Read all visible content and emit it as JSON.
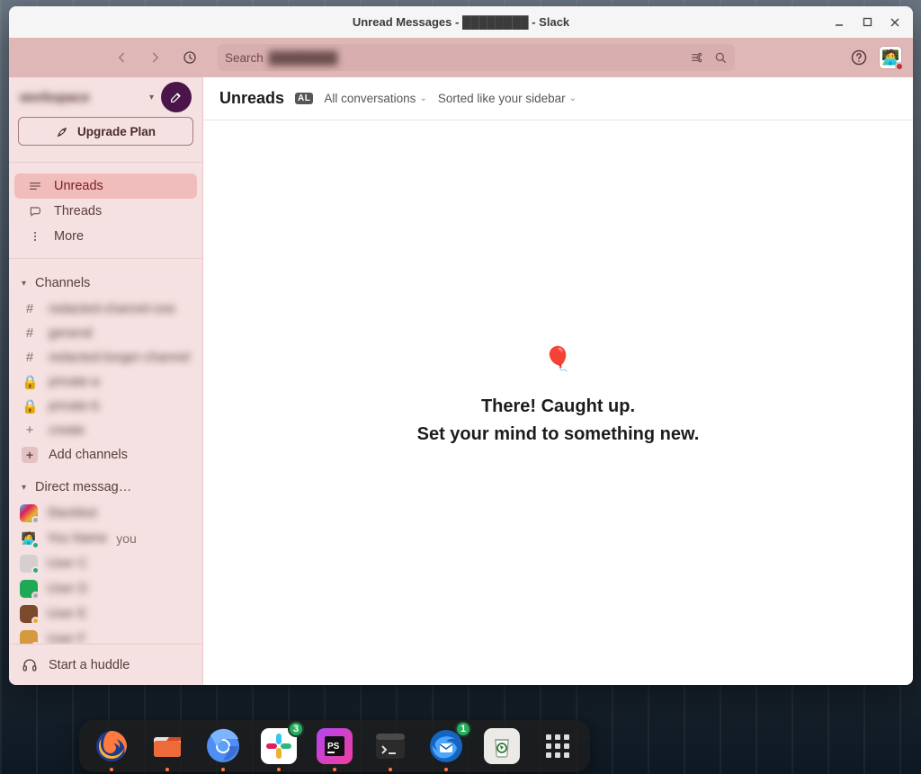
{
  "titlebar": {
    "title": "Unread Messages - ████████ - Slack"
  },
  "toolbar": {
    "search_label": "Search",
    "search_value": "████████"
  },
  "sidebar": {
    "workspace_name": "workspace",
    "upgrade_label": "Upgrade Plan",
    "items": [
      {
        "label": "Unreads"
      },
      {
        "label": "Threads"
      },
      {
        "label": "More"
      }
    ],
    "channels_header": "Channels",
    "channels": [
      {
        "kind": "hash",
        "label": "redacted-channel-one"
      },
      {
        "kind": "hash",
        "label": "general"
      },
      {
        "kind": "hash",
        "label": "redacted-longer-channel"
      },
      {
        "kind": "lock",
        "label": "private-a"
      },
      {
        "kind": "lock",
        "label": "private-b"
      },
      {
        "kind": "plus",
        "label": "create"
      }
    ],
    "add_channels_label": "Add channels",
    "dm_header": "Direct messag…",
    "you_suffix": "you",
    "dms": [
      {
        "name": "Slackbot",
        "bg": "linear-gradient(135deg,#36c5f0,#e01e5a,#ecb22e,#2eb67d)",
        "dot": "#aaa"
      },
      {
        "name": "You Name",
        "bg": "#f5e1e1",
        "dot": "#2bac76",
        "self": true,
        "emoji": "🧑‍💻"
      },
      {
        "name": "User C",
        "bg": "#d6cfcf",
        "dot": "#2bac76"
      },
      {
        "name": "User D",
        "bg": "#1fa956",
        "dot": "#aaa"
      },
      {
        "name": "User E",
        "bg": "#7a4a2a",
        "dot": "#f5a623"
      },
      {
        "name": "User F",
        "bg": "#d69a3e",
        "dot": "#f5a623"
      }
    ],
    "huddle_label": "Start a huddle"
  },
  "main": {
    "title": "Unreads",
    "kbd": "AL",
    "filter1": "All conversations",
    "filter2": "Sorted like your sidebar",
    "empty_line1": "There! Caught up.",
    "empty_line2": "Set your mind to something new."
  },
  "dock": {
    "apps": [
      {
        "name": "firefox",
        "running": true
      },
      {
        "name": "files",
        "running": true
      },
      {
        "name": "chromium",
        "running": true
      },
      {
        "name": "slack",
        "running": true,
        "badge": "3"
      },
      {
        "name": "phpstorm",
        "running": true
      },
      {
        "name": "terminal",
        "running": true
      },
      {
        "name": "thunderbird",
        "running": true,
        "badge": "1"
      },
      {
        "name": "trash",
        "running": false
      },
      {
        "name": "apps-grid",
        "running": false
      }
    ]
  }
}
